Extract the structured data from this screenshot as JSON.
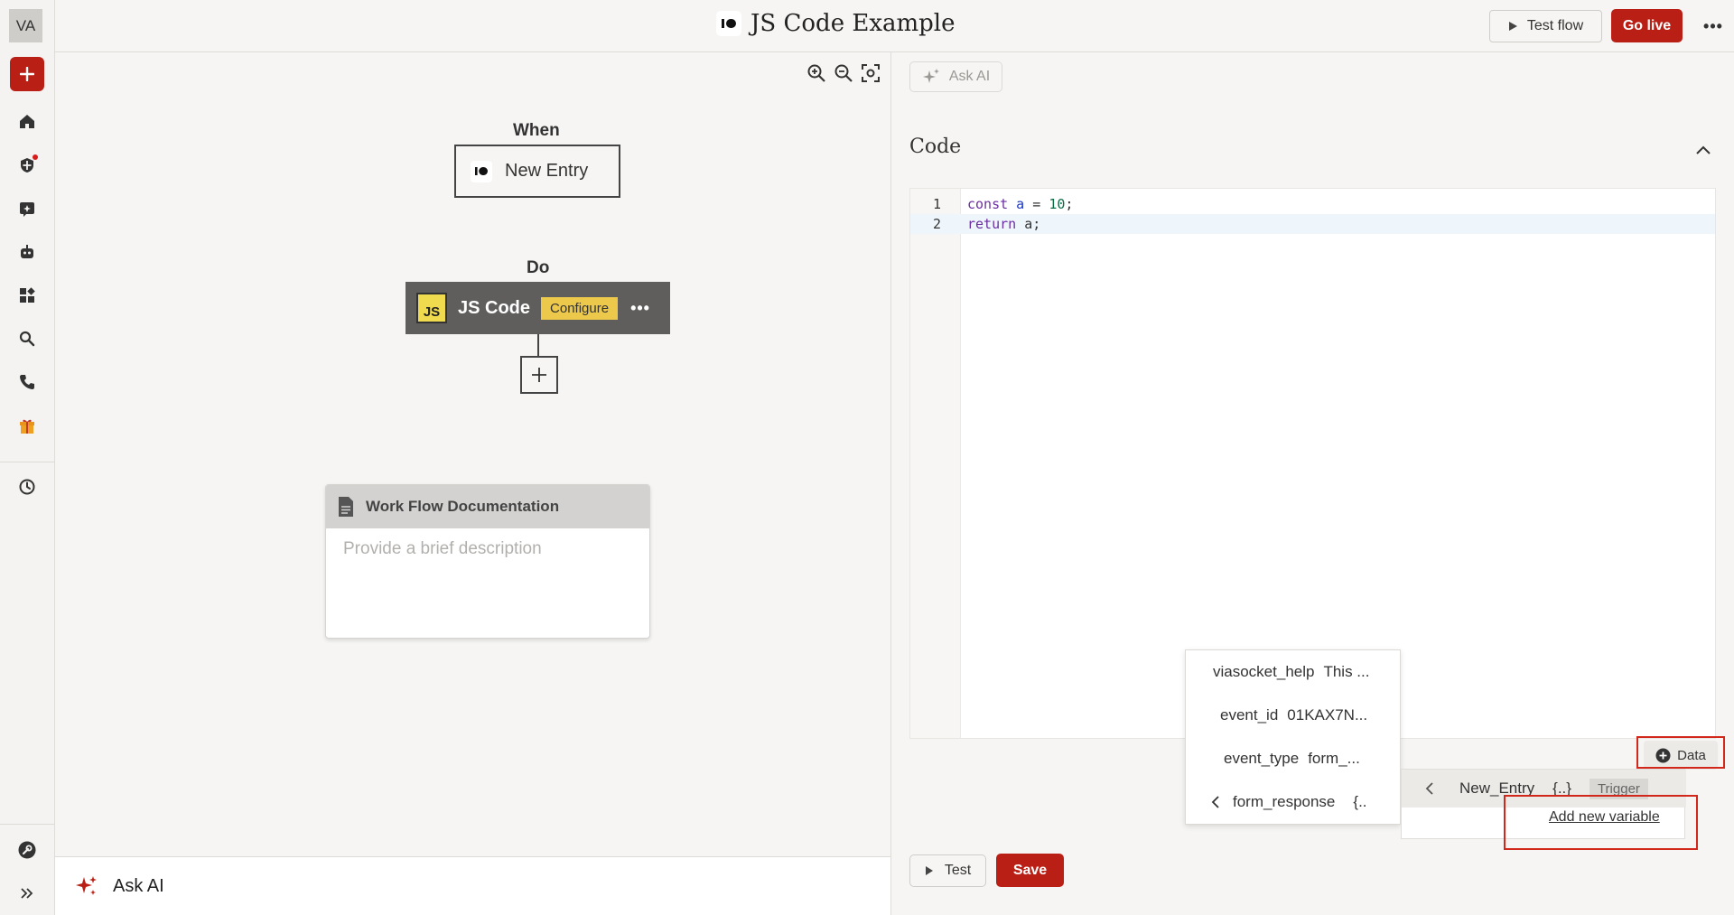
{
  "user": {
    "initials": "VA"
  },
  "header": {
    "title": "JS Code Example",
    "test_flow_label": "Test flow",
    "go_live_label": "Go live",
    "more_label": "•••"
  },
  "sidebar": {
    "items": [
      {
        "name": "home-icon"
      },
      {
        "name": "shield-icon",
        "notification": true
      },
      {
        "name": "ai-sparkle-icon"
      },
      {
        "name": "bot-icon"
      },
      {
        "name": "apps-icon"
      },
      {
        "name": "search-icon"
      },
      {
        "name": "phone-icon"
      },
      {
        "name": "gift-icon"
      },
      {
        "name": "history-icon"
      },
      {
        "name": "support-icon"
      },
      {
        "name": "expand-icon"
      }
    ]
  },
  "flow": {
    "when_label": "When",
    "trigger_label": "New Entry",
    "do_label": "Do",
    "action_logo": "JS",
    "action_label": "JS Code",
    "configure_label": "Configure",
    "action_more": "•••",
    "doc_title": "Work Flow Documentation",
    "doc_placeholder": "Provide a brief description"
  },
  "bottom_ask": {
    "label": "Ask AI"
  },
  "panel": {
    "ask_ai_label": "Ask AI",
    "code_heading": "Code",
    "code_lines": [
      {
        "num": "1",
        "tokens": [
          "const",
          " a",
          " = ",
          "10",
          ";"
        ]
      },
      {
        "num": "2",
        "tokens": [
          "return",
          " a;"
        ]
      }
    ],
    "suggestions": [
      {
        "key": "viasocket_help",
        "value": "This ..."
      },
      {
        "key": "event_id",
        "value": "01KAX7N..."
      },
      {
        "key": "event_type",
        "value": "form_..."
      },
      {
        "key": "form_response",
        "value": "{..",
        "has_back": true
      }
    ],
    "data_label": "Data",
    "var_panel": {
      "node_label": "New_Entry",
      "node_value": "{..}",
      "tag": "Trigger",
      "add_variable_label": "Add new variable"
    },
    "test_label": "Test",
    "save_label": "Save"
  },
  "colors": {
    "brand_red": "#b91f14",
    "highlight_red": "#d2271b",
    "configure_yellow": "#ecc94b",
    "js_yellow": "#f0db4f"
  }
}
